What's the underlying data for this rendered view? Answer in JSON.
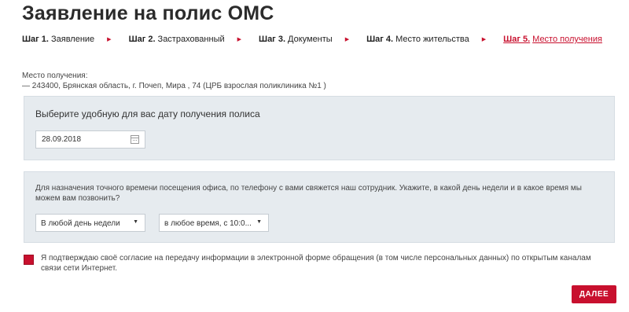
{
  "page": {
    "title": "Заявление на полис ОМС"
  },
  "steps": [
    {
      "num": "Шаг 1.",
      "label": "Заявление"
    },
    {
      "num": "Шаг 2.",
      "label": "Застрахованный"
    },
    {
      "num": "Шаг 3.",
      "label": "Документы"
    },
    {
      "num": "Шаг 4.",
      "label": "Место жительства"
    },
    {
      "num": "Шаг 5.",
      "label": "Место получения"
    }
  ],
  "place": {
    "label": "Место получения:",
    "value": "— 243400, Брянская область, г. Почеп, Мира , 74 (ЦРБ взрослая поликлиника №1 )"
  },
  "date_panel": {
    "heading": "Выберите удобную для вас дату получения полиса",
    "date_value": "28.09.2018"
  },
  "call_panel": {
    "text": "Для назначения точного времени посещения офиса, по телефону с вами свяжется наш сотрудник. Укажите, в какой день недели и в какое время мы можем вам позвонить?",
    "day_selected": "В любой день недели",
    "time_selected": "в любое время, с 10:0..."
  },
  "consent": {
    "checked": true,
    "text": "Я подтверждаю своё согласие на передачу информации в электронной форме обращения (в том числе персональных данных) по открытым каналам связи сети Интернет."
  },
  "buttons": {
    "next_label": "ДАЛЕЕ"
  },
  "colors": {
    "accent": "#c8102e",
    "panel_bg": "#e6ebef"
  }
}
